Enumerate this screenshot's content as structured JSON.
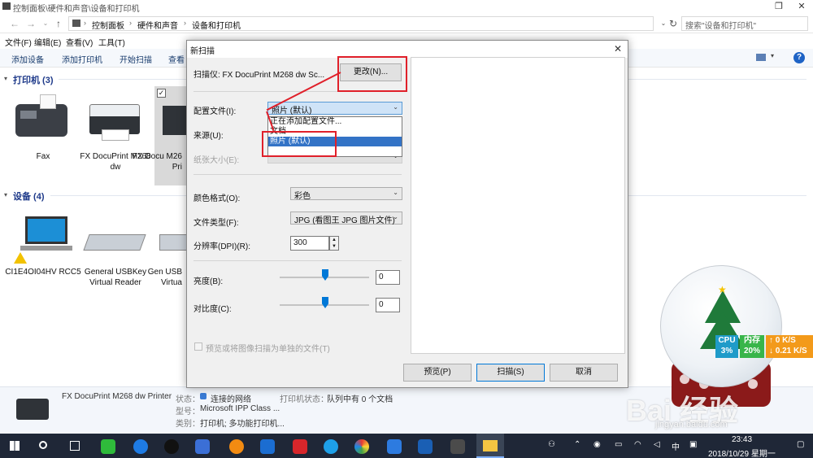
{
  "window": {
    "title": "控制面板\\硬件和声音\\设备和打印机",
    "breadcrumb": [
      "控制面板",
      "硬件和声音",
      "设备和打印机"
    ],
    "search_placeholder": "搜索\"设备和打印机\""
  },
  "menu": [
    "文件(F)",
    "编辑(E)",
    "查看(V)",
    "工具(T)"
  ],
  "commands": [
    "添加设备",
    "添加打印机",
    "开始扫描",
    "查看"
  ],
  "printers": {
    "heading": "打印机 (3)",
    "items": [
      {
        "name": "Fax"
      },
      {
        "name": "FX DocuPrint M268 dw"
      },
      {
        "name": "FX Docu M26 Pri"
      }
    ]
  },
  "devices": {
    "heading": "设备 (4)",
    "items": [
      {
        "name": "CI1E4OI04HV RCC5"
      },
      {
        "name": "General USBKey Virtual Reader"
      },
      {
        "name": "Gen USB Virtua"
      }
    ]
  },
  "details": {
    "device_name": "FX DocuPrint M268 dw Printer",
    "status_label": "状态：",
    "status_value": "连接的网络",
    "model_label": "型号：",
    "model_value": "Microsoft IPP Class ...",
    "category_label": "类别：",
    "category_value": "打印机; 多功能打印机...",
    "printer_status_label": "打印机状态：",
    "printer_status_value": "队列中有 0 个文档"
  },
  "dialog": {
    "title": "新扫描",
    "scanner_label": "扫描仪: FX DocuPrint M268 dw Sc...",
    "change_button": "更改(N)...",
    "profile_label": "配置文件(I):",
    "profile_value": "照片 (默认)",
    "profile_options": [
      "正在添加配置文件...",
      "文档",
      "照片 (默认)"
    ],
    "source_label": "来源(U):",
    "paper_size_label": "纸张大小(E):",
    "color_format_label": "颜色格式(O):",
    "color_format_value": "彩色",
    "file_type_label": "文件类型(F):",
    "file_type_value": "JPG (看图王 JPG 图片文件)",
    "resolution_label": "分辨率(DPI)(R):",
    "resolution_value": "300",
    "brightness_label": "亮度(B):",
    "brightness_value": "0",
    "contrast_label": "对比度(C):",
    "contrast_value": "0",
    "checkbox_label": "预览或将图像扫描为单独的文件(T)",
    "preview_button": "预览(P)",
    "scan_button": "扫描(S)",
    "cancel_button": "取消"
  },
  "monitor": {
    "cpu_label": "CPU",
    "cpu_value": "3%",
    "mem_label": "内存",
    "mem_value": "20%",
    "up_value": "0 K/S",
    "down_value": "0.21 K/S"
  },
  "taskbar": {
    "ime": "中",
    "time": "23:43",
    "date": "2018/10/29 星期一"
  },
  "watermark": {
    "brand": "Bai 经验",
    "url": "jingyan.baidu.com"
  }
}
